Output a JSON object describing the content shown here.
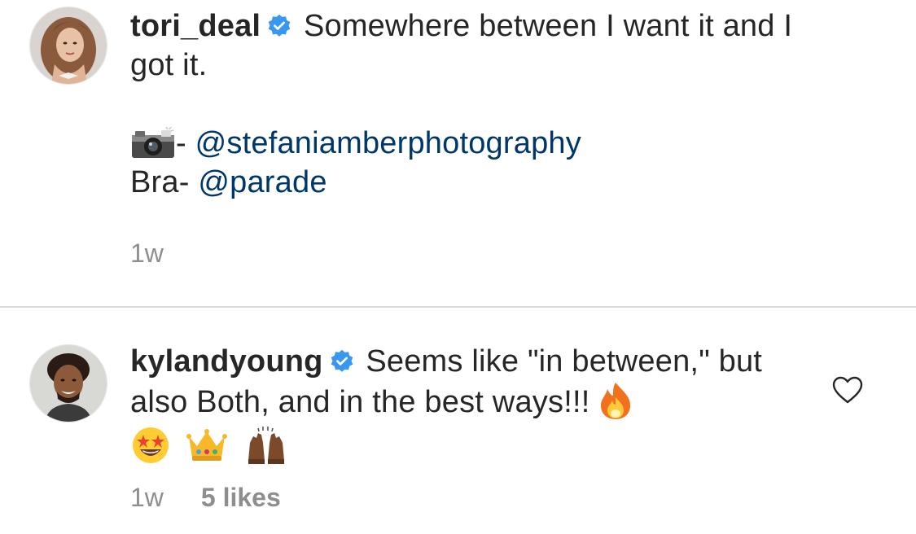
{
  "caption": {
    "username": "tori_deal",
    "verified": true,
    "text_line1": "Somewhere between I want it and I got it.",
    "camera_icon": "camera-with-flash-emoji",
    "credit_separator": "- ",
    "photo_mention": "@stefaniamberphotography",
    "bra_label": "Bra- ",
    "bra_mention": "@parade",
    "time": "1w"
  },
  "reply": {
    "username": "kylandyoung",
    "verified": true,
    "text": "Seems like \"in between,\" but also Both, and in the best ways!!!",
    "emojis": [
      "fire-emoji",
      "star-struck-emoji",
      "crown-emoji",
      "raising-hands-emoji"
    ],
    "time": "1w",
    "likes": "5 likes"
  },
  "colors": {
    "text": "#262626",
    "mention": "#00376b",
    "meta": "#8e8e8e",
    "verified_badge": "#3897f0",
    "divider": "#dbdbdb"
  }
}
